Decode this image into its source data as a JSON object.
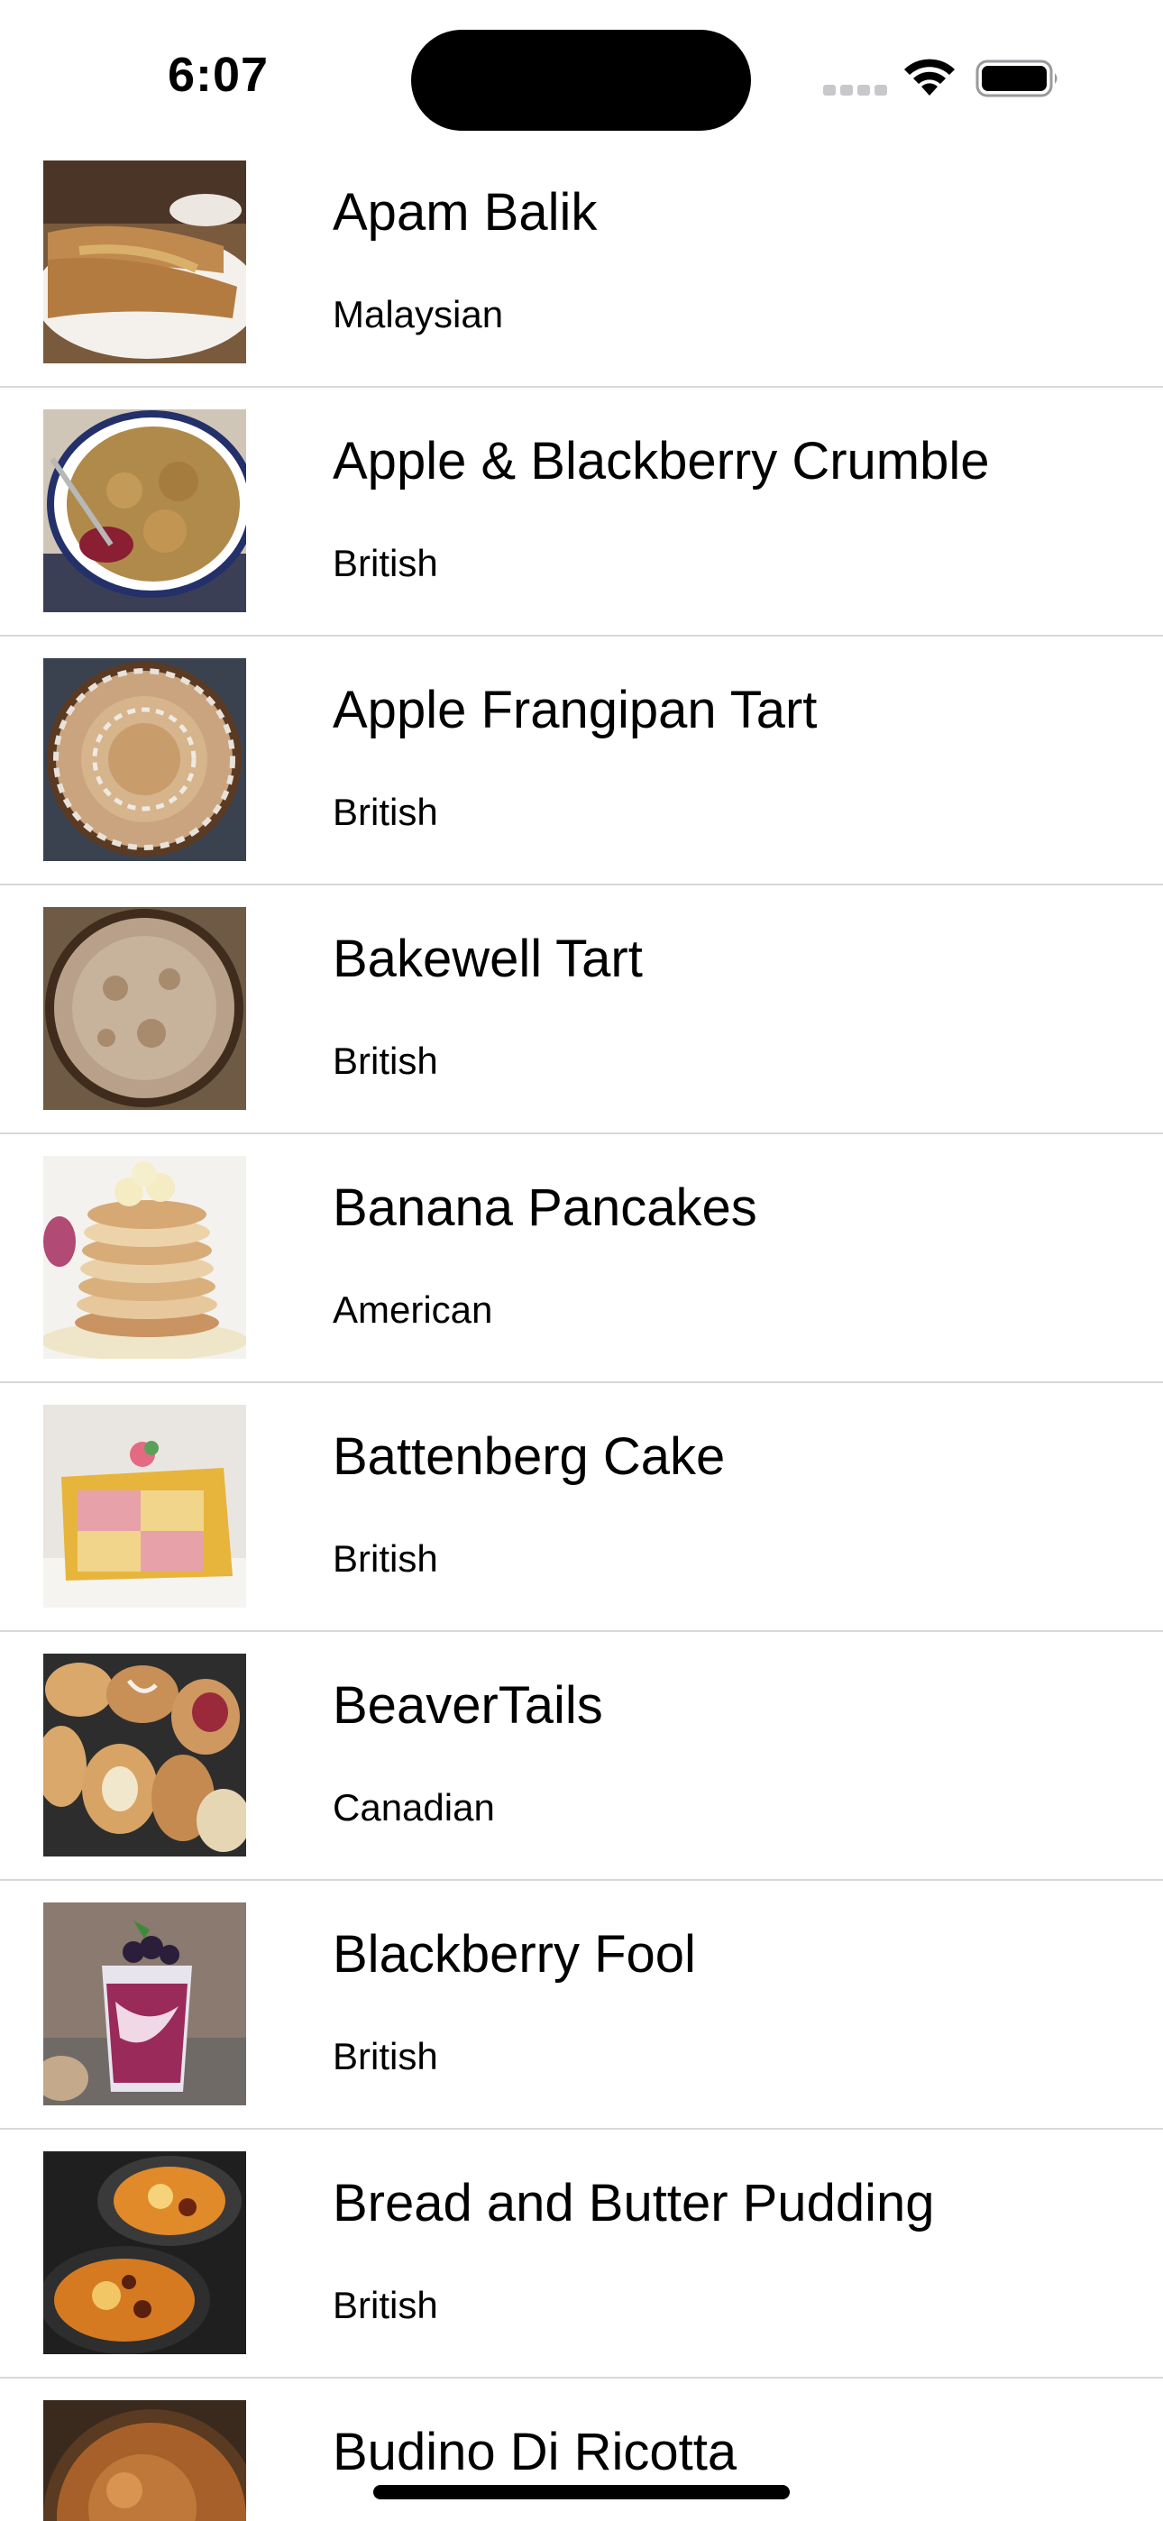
{
  "status_bar": {
    "time": "6:07",
    "signal_icon": "cellular-signal-icon",
    "wifi_icon": "wifi-icon",
    "battery_icon": "battery-icon"
  },
  "recipes": [
    {
      "name": "Apam Balik",
      "area": "Malaysian",
      "thumbnail": "apam-balik-photo"
    },
    {
      "name": "Apple & Blackberry Crumble",
      "area": "British",
      "thumbnail": "crumble-photo"
    },
    {
      "name": "Apple Frangipan Tart",
      "area": "British",
      "thumbnail": "frangipan-tart-photo"
    },
    {
      "name": "Bakewell Tart",
      "area": "British",
      "thumbnail": "bakewell-tart-photo"
    },
    {
      "name": "Banana Pancakes",
      "area": "American",
      "thumbnail": "banana-pancakes-photo"
    },
    {
      "name": "Battenberg Cake",
      "area": "British",
      "thumbnail": "battenberg-cake-photo"
    },
    {
      "name": "BeaverTails",
      "area": "Canadian",
      "thumbnail": "beavertails-photo"
    },
    {
      "name": "Blackberry Fool",
      "area": "British",
      "thumbnail": "blackberry-fool-photo"
    },
    {
      "name": "Bread and Butter Pudding",
      "area": "British",
      "thumbnail": "bread-butter-pudding-photo"
    },
    {
      "name": "Budino Di Ricotta",
      "area": "",
      "thumbnail": "budino-di-ricotta-photo"
    }
  ],
  "colors": {
    "separator": "#d8d8dc",
    "text": "#000000",
    "background": "#ffffff"
  }
}
